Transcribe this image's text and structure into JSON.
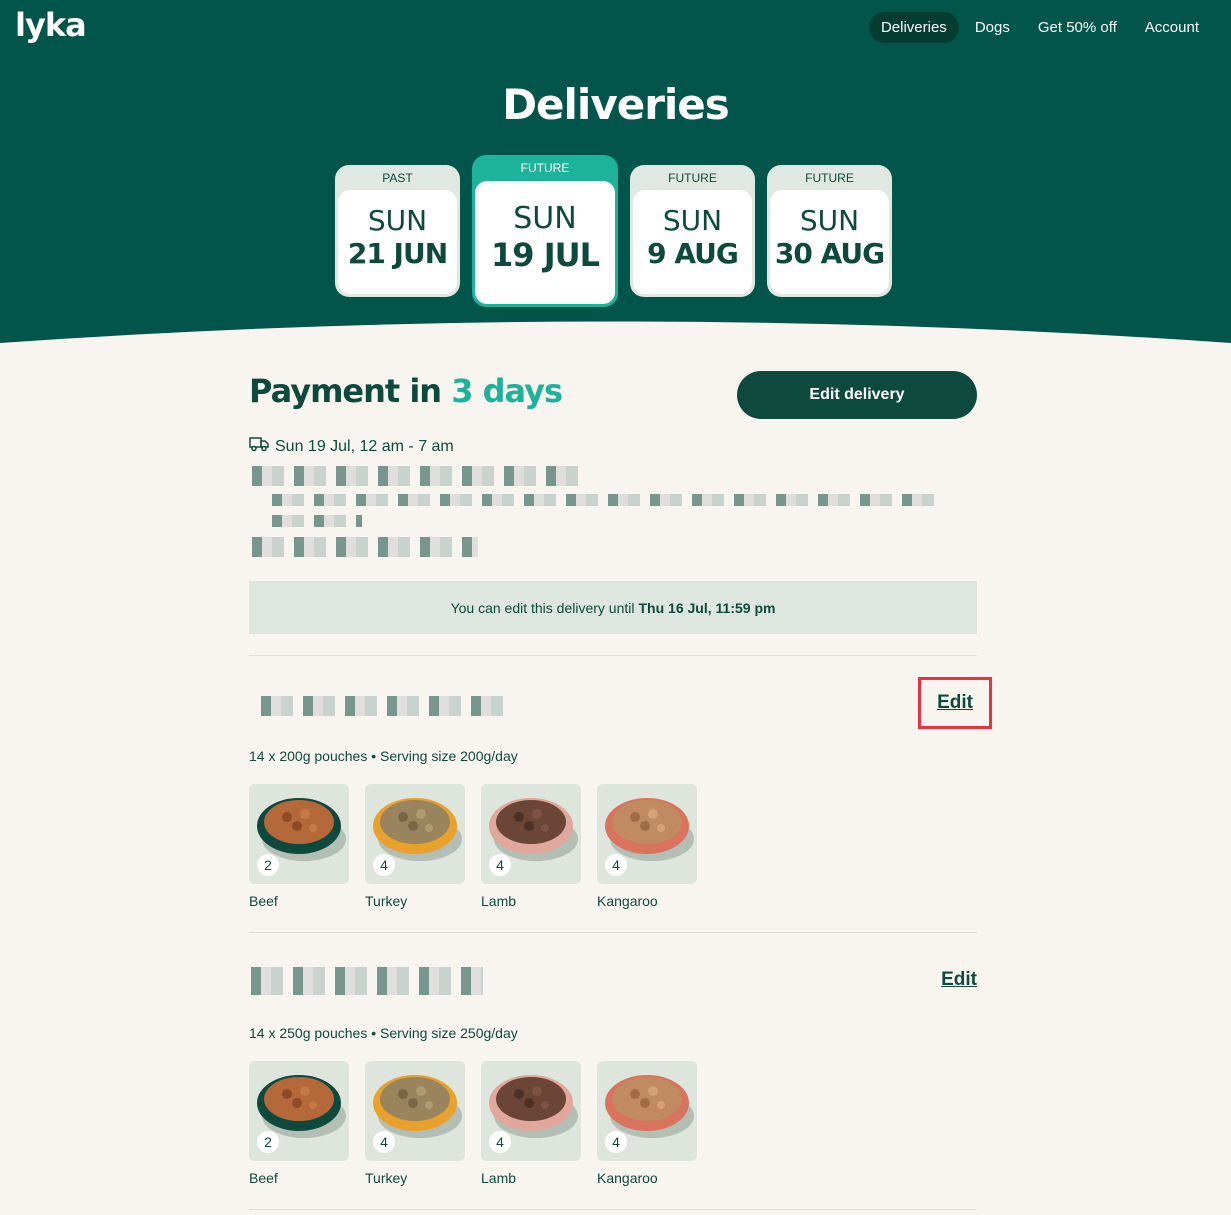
{
  "brand": {
    "logo": "lyka"
  },
  "nav": {
    "items": [
      "Deliveries",
      "Dogs",
      "Get 50% off",
      "Account"
    ]
  },
  "page": {
    "title": "Deliveries"
  },
  "tabs": [
    {
      "tag": "PAST",
      "dow": "SUN",
      "date": "21 JUN"
    },
    {
      "tag": "FUTURE",
      "dow": "SUN",
      "date": "19 JUL"
    },
    {
      "tag": "FUTURE",
      "dow": "SUN",
      "date": "9 AUG"
    },
    {
      "tag": "FUTURE",
      "dow": "SUN",
      "date": "30 AUG"
    }
  ],
  "payment": {
    "prefix": "Payment in",
    "accent": "3 days",
    "edit_delivery": "Edit delivery"
  },
  "delivery": {
    "window": "Sun 19 Jul, 12 am - 7 am"
  },
  "notice": {
    "text": "You can edit this delivery until",
    "deadline": "Thu 16 Jul, 11:59 pm"
  },
  "plans": [
    {
      "edit": "Edit",
      "pouches": "14 x 200g pouches • Serving size 200g/day",
      "recipes": [
        {
          "name": "Beef",
          "qty": "2"
        },
        {
          "name": "Turkey",
          "qty": "4"
        },
        {
          "name": "Lamb",
          "qty": "4"
        },
        {
          "name": "Kangaroo",
          "qty": "4"
        }
      ]
    },
    {
      "edit": "Edit",
      "pouches": "14 x 250g pouches • Serving size 250g/day",
      "recipes": [
        {
          "name": "Beef",
          "qty": "2"
        },
        {
          "name": "Turkey",
          "qty": "4"
        },
        {
          "name": "Lamb",
          "qty": "4"
        },
        {
          "name": "Kangaroo",
          "qty": "4"
        }
      ]
    }
  ],
  "colors": {
    "brand_dark": "#02554a",
    "accent": "#1db39a",
    "text": "#0d4a3d",
    "background": "#f8f5f1"
  }
}
